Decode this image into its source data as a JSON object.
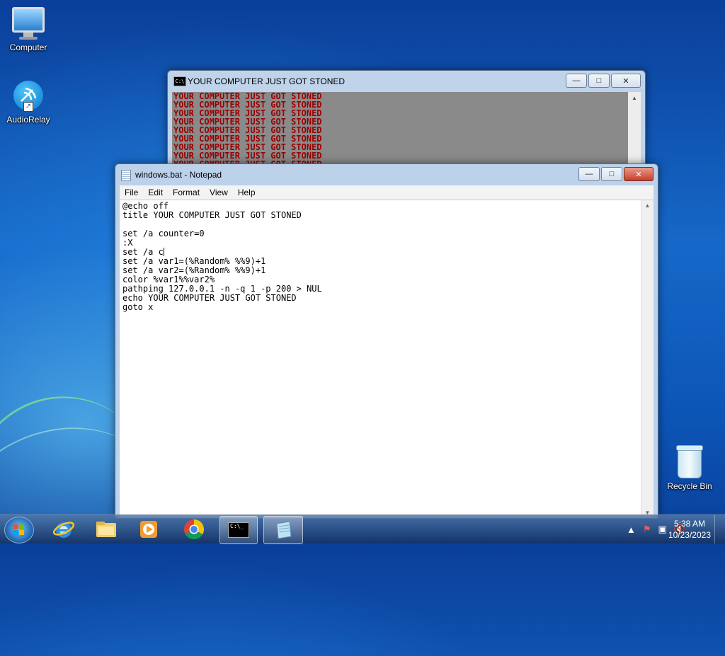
{
  "desktop": {
    "icons": [
      {
        "label": "Computer"
      },
      {
        "label": "AudioRelay"
      },
      {
        "label": "Recycle Bin"
      }
    ]
  },
  "cmd_window": {
    "title": "YOUR COMPUTER JUST GOT STONED",
    "lines": [
      "YOUR COMPUTER JUST GOT STONED",
      "YOUR COMPUTER JUST GOT STONED",
      "YOUR COMPUTER JUST GOT STONED",
      "YOUR COMPUTER JUST GOT STONED",
      "YOUR COMPUTER JUST GOT STONED",
      "YOUR COMPUTER JUST GOT STONED",
      "YOUR COMPUTER JUST GOT STONED",
      "YOUR COMPUTER JUST GOT STONED",
      "YOUR COMPUTER JUST GOT STONED"
    ],
    "text_color": "#9a0000",
    "background": "#8a8a8a"
  },
  "notepad": {
    "title": "windows.bat - Notepad",
    "menu": [
      "File",
      "Edit",
      "Format",
      "View",
      "Help"
    ],
    "content_before_caret": "@echo off\ntitle YOUR COMPUTER JUST GOT STONED\n\nset /a counter=0\n:X\nset /a c",
    "content_after_caret": "\nset /a var1=(%Random% %%9)+1\nset /a var2=(%Random% %%9)+1\ncolor %var1%%var2%\npathping 127.0.0.1 -n -q 1 -p 200 > NUL\necho YOUR COMPUTER JUST GOT STONED\ngoto x"
  },
  "taskbar": {
    "pinned": [
      "start-button",
      "internet-explorer-icon",
      "file-explorer-icon",
      "media-player-icon",
      "chrome-icon",
      "cmd-icon",
      "notepad-icon"
    ],
    "clock": {
      "time": "5:38 AM",
      "date": "10/23/2023"
    }
  }
}
